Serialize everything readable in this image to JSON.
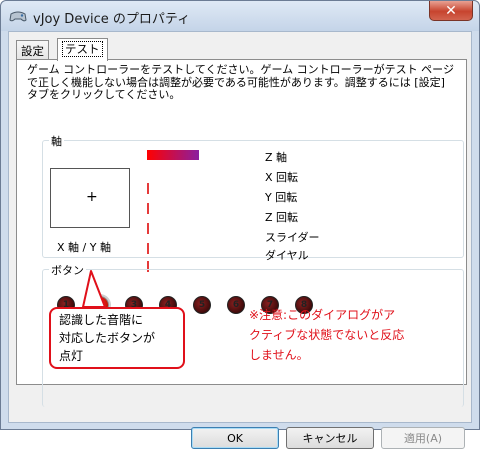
{
  "window": {
    "title": "vJoy Device のプロパティ",
    "close_label": "✕"
  },
  "tabs": [
    {
      "label": "設定",
      "active": false
    },
    {
      "label": "テスト",
      "active": true
    }
  ],
  "description": "ゲーム コントローラーをテストしてください。ゲーム コントローラーがテスト ページで正しく機能しない場合は調整が必要である可能性があります。調整するには [設定] タブをクリックしてください。",
  "axes_group": {
    "label": "軸",
    "xy_label": "X 軸 / Y 軸",
    "crosshair": "+",
    "axes": [
      {
        "label": "Z 軸",
        "value": 0.35
      },
      {
        "label": "X 回転",
        "value": 0
      },
      {
        "label": "Y 回転",
        "value": 0
      },
      {
        "label": "Z 回転",
        "value": 0
      },
      {
        "label": "スライダー",
        "value": 0
      },
      {
        "label": "ダイヤル",
        "value": 0
      }
    ]
  },
  "buttons_group": {
    "label": "ボタン",
    "buttons": [
      {
        "number": "1",
        "lit": false
      },
      {
        "number": "2",
        "lit": true
      },
      {
        "number": "3",
        "lit": false
      },
      {
        "number": "4",
        "lit": false
      },
      {
        "number": "5",
        "lit": false
      },
      {
        "number": "6",
        "lit": false
      },
      {
        "number": "7",
        "lit": false
      },
      {
        "number": "8",
        "lit": false
      }
    ]
  },
  "annotations": {
    "callout": [
      "認識した音階に",
      "対応したボタンが",
      "点灯"
    ],
    "note": [
      "※注意:このダイアログがア",
      "クティブな状態でないと反応",
      "しません。"
    ]
  },
  "dialog_buttons": {
    "ok": "OK",
    "cancel": "キャンセル",
    "apply": "適用(A)"
  },
  "colors": {
    "highlight_red": "#e0101a",
    "lit_button": "#ff2a1a"
  }
}
